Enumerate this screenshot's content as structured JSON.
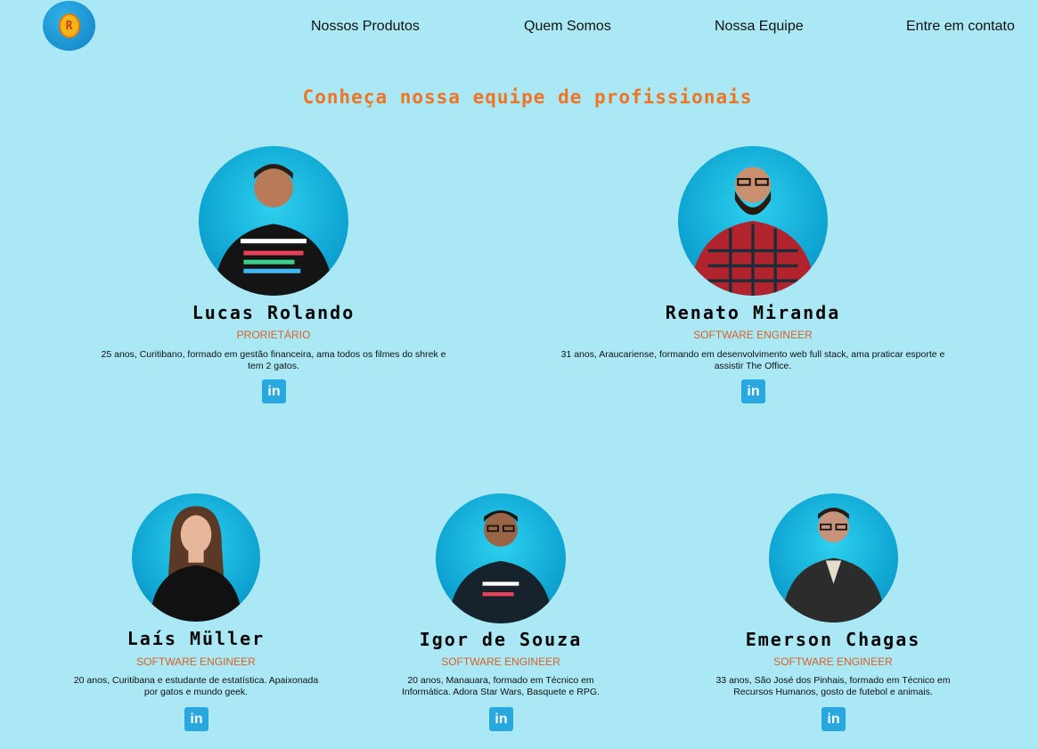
{
  "nav": {
    "logo_letter": "R",
    "items": [
      {
        "label": "Nossos Produtos"
      },
      {
        "label": "Quem Somos"
      },
      {
        "label": "Nossa Equipe"
      },
      {
        "label": "Entre em contato"
      }
    ]
  },
  "page": {
    "title": "Conheça nossa equipe de profissionais"
  },
  "team": [
    {
      "name": "Lucas Rolando",
      "role": "PRORIETÁRIO",
      "bio": "25 anos, Curitibano, formado em gestão financeira, ama todos os filmes do shrek e tem 2 gatos.",
      "linkedin_label": "in"
    },
    {
      "name": "Renato Miranda",
      "role": "SOFTWARE ENGINEER",
      "bio": "31 anos, Araucariense, formando em desenvolvimento web full stack, ama praticar esporte e assistir The Office.",
      "linkedin_label": "in"
    },
    {
      "name": "Laís Müller",
      "role": "SOFTWARE ENGINEER",
      "bio": "20 anos, Curitibana e estudante de estatística. Apaixonada por gatos e mundo geek.",
      "linkedin_label": "in"
    },
    {
      "name": "Igor de Souza",
      "role": "SOFTWARE ENGINEER",
      "bio": "20 anos, Manauara, formado em Técnico em Informática. Adora Star Wars, Basquete e RPG.",
      "linkedin_label": "in"
    },
    {
      "name": "Emerson Chagas",
      "role": "SOFTWARE ENGINEER",
      "bio": "33 anos, São José dos Pinhais, formado em Técnico em Recursos Humanos, gosto de futebol e animais.",
      "linkedin_label": "in"
    }
  ],
  "colors": {
    "background": "#a9e8f4",
    "title": "#ef7426",
    "role": "#d8612a",
    "linkedin": "#29a8e0"
  }
}
